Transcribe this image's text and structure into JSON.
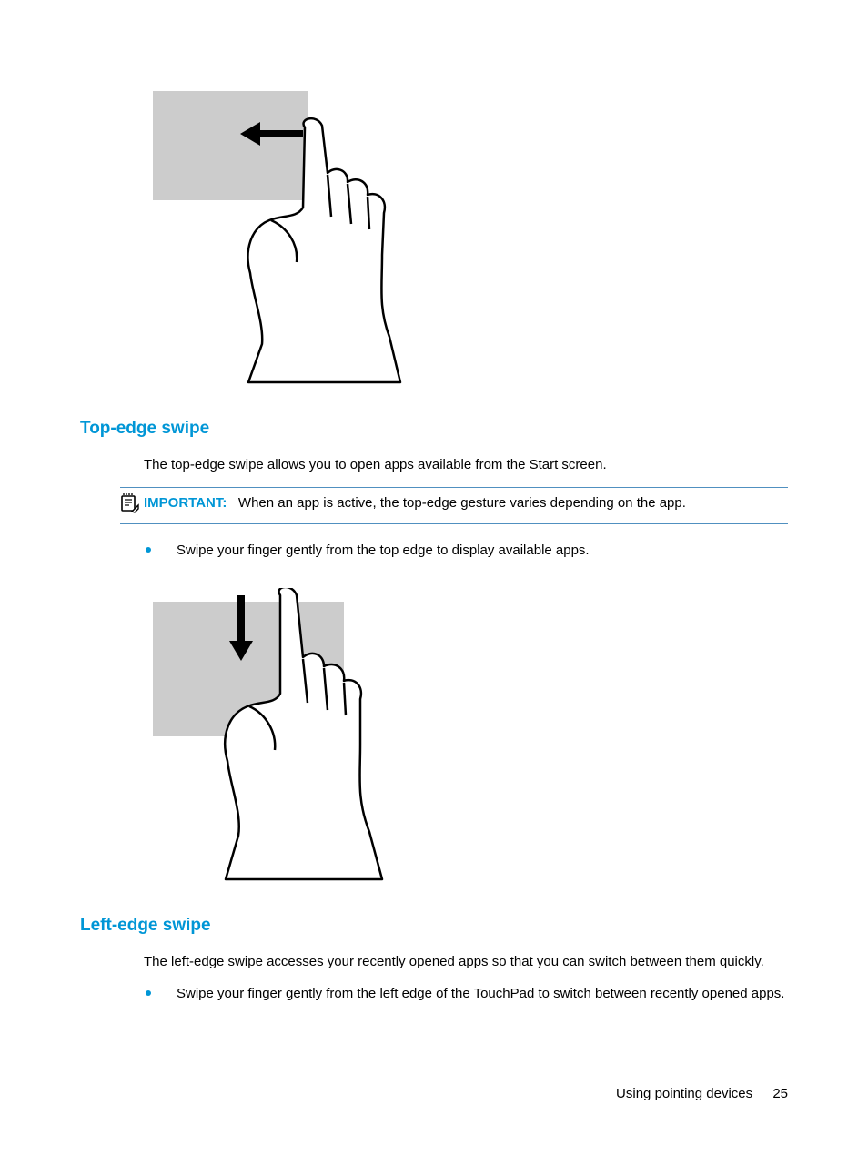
{
  "section1": {
    "heading": "Top-edge swipe",
    "intro": "The top-edge swipe allows you to open apps available from the Start screen.",
    "important_label": "IMPORTANT:",
    "important_text": "When an app is active, the top-edge gesture varies depending on the app.",
    "bullet1": "Swipe your finger gently from the top edge to display available apps."
  },
  "section2": {
    "heading": "Left-edge swipe",
    "intro": "The left-edge swipe accesses your recently opened apps so that you can switch between them quickly.",
    "bullet1": "Swipe your finger gently from the left edge of the TouchPad to switch between recently opened apps."
  },
  "footer": {
    "section_name": "Using pointing devices",
    "page_number": "25"
  }
}
